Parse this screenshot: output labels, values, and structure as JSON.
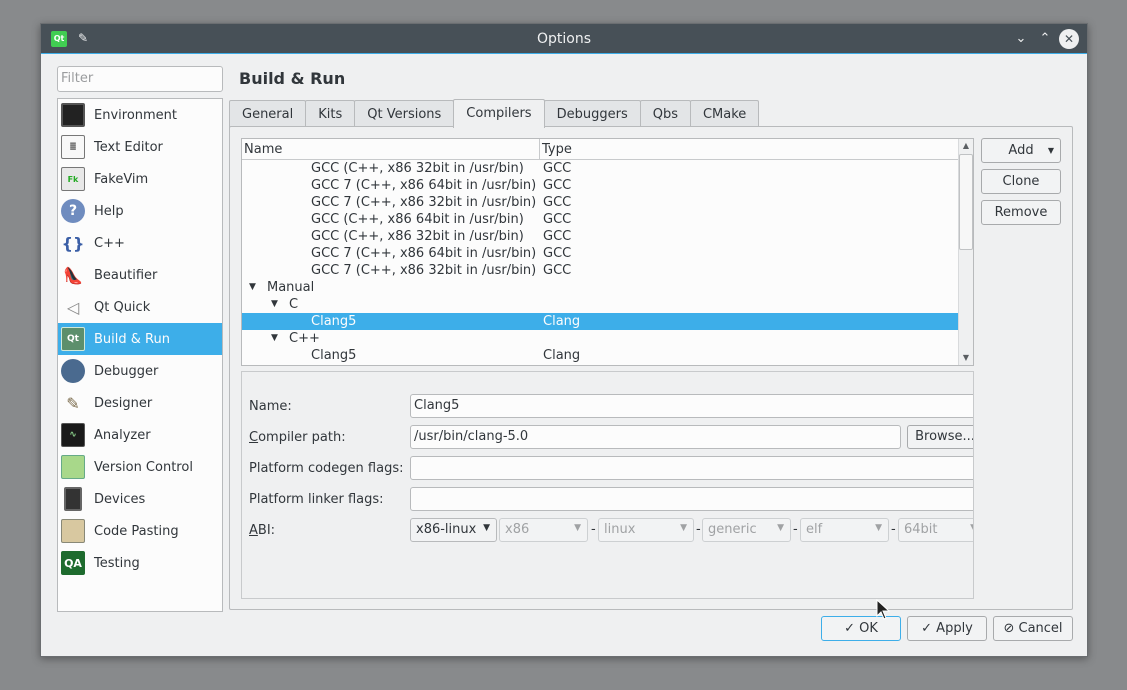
{
  "window": {
    "title": "Options"
  },
  "filter": {
    "placeholder": "Filter"
  },
  "sidebar": {
    "items": [
      {
        "label": "Environment",
        "icon": "monitor-icon"
      },
      {
        "label": "Text Editor",
        "icon": "text-editor-icon"
      },
      {
        "label": "FakeVim",
        "icon": "fakevim-icon"
      },
      {
        "label": "Help",
        "icon": "help-icon"
      },
      {
        "label": "C++",
        "icon": "cpp-braces-icon"
      },
      {
        "label": "Beautifier",
        "icon": "high-heel-icon"
      },
      {
        "label": "Qt Quick",
        "icon": "paper-plane-icon"
      },
      {
        "label": "Build & Run",
        "icon": "qt-build-icon"
      },
      {
        "label": "Debugger",
        "icon": "bug-icon"
      },
      {
        "label": "Designer",
        "icon": "pen-icon"
      },
      {
        "label": "Analyzer",
        "icon": "oscilloscope-icon"
      },
      {
        "label": "Version Control",
        "icon": "version-control-icon"
      },
      {
        "label": "Devices",
        "icon": "device-icon"
      },
      {
        "label": "Code Pasting",
        "icon": "code-pasting-icon"
      },
      {
        "label": "Testing",
        "icon": "qa-icon"
      }
    ],
    "selected_index": 7
  },
  "page": {
    "title": "Build & Run"
  },
  "tabs": [
    "General",
    "Kits",
    "Qt Versions",
    "Compilers",
    "Debuggers",
    "Qbs",
    "CMake"
  ],
  "active_tab": "Compilers",
  "tree": {
    "headers": {
      "name": "Name",
      "type": "Type"
    },
    "rows": [
      {
        "name": "GCC (C++, x86 32bit in /usr/bin)",
        "type": "GCC"
      },
      {
        "name": "GCC 7 (C++, x86 64bit in /usr/bin)",
        "type": "GCC"
      },
      {
        "name": "GCC 7 (C++, x86 32bit in /usr/bin)",
        "type": "GCC"
      },
      {
        "name": "GCC (C++, x86 64bit in /usr/bin)",
        "type": "GCC"
      },
      {
        "name": "GCC (C++, x86 32bit in /usr/bin)",
        "type": "GCC"
      },
      {
        "name": "GCC 7 (C++, x86 64bit in /usr/bin)",
        "type": "GCC"
      },
      {
        "name": "GCC 7 (C++, x86 32bit in /usr/bin)",
        "type": "GCC"
      },
      {
        "name": "Manual",
        "type": ""
      },
      {
        "name": "C",
        "type": ""
      },
      {
        "name": "Clang5",
        "type": "Clang"
      },
      {
        "name": "C++",
        "type": ""
      },
      {
        "name": "Clang5",
        "type": "Clang"
      }
    ]
  },
  "buttons": {
    "add": "Add",
    "clone": "Clone",
    "remove": "Remove"
  },
  "details": {
    "name_label": "Name:",
    "name_value": "Clang5",
    "compiler_path_label_c": "C",
    "compiler_path_label_rest": "ompiler path:",
    "compiler_path_value": "/usr/bin/clang-5.0",
    "browse": "Browse...",
    "codegen_label": "Platform codegen flags:",
    "codegen_value": "",
    "linker_label": "Platform linker flags:",
    "linker_value": "",
    "abi_label_a": "A",
    "abi_label_rest": "BI:",
    "abi": [
      "x86-linux",
      "x86",
      "linux",
      "generic",
      "elf",
      "64bit"
    ],
    "abi_sep": "-"
  },
  "footer": {
    "ok": "OK",
    "apply": "Apply",
    "cancel": "Cancel"
  }
}
